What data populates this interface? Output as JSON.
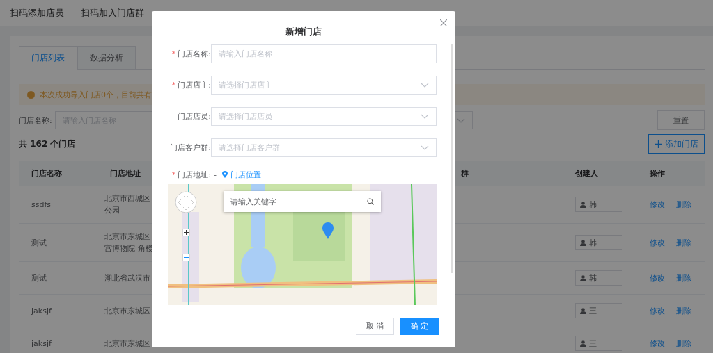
{
  "top_nav": {
    "items": [
      {
        "label": "扫码添加店员"
      },
      {
        "label": "扫码加入门店群"
      }
    ]
  },
  "tabs": [
    {
      "label": "门店列表",
      "selected": true
    },
    {
      "label": "数据分析",
      "selected": false
    }
  ],
  "alert": {
    "text": "本次成功导入门店0个，目前共有"
  },
  "filter": {
    "label": "门店名称:",
    "placeholder": "请输入门店名称",
    "reset_button": "重置"
  },
  "summary": "共 162 个门店",
  "add_button": "添加门店",
  "table": {
    "columns": [
      "门店名称",
      "门店地址",
      "群",
      "创建人",
      "操作"
    ],
    "rows": [
      {
        "name": "ssdfs",
        "address": [
          "北京市西城区",
          "公园"
        ],
        "creator": "韩",
        "actions": [
          "修改",
          "删除"
        ]
      },
      {
        "name": "测试",
        "address": [
          "北京市东城区",
          "宫博物院-角楼"
        ],
        "creator": "韩",
        "actions": [
          "修改",
          "删除"
        ]
      },
      {
        "name": "测试",
        "address": [
          "湖北省武汉市"
        ],
        "creator": "韩",
        "actions": [
          "修改",
          "删除"
        ]
      },
      {
        "name": "jaksjf",
        "address": [
          "北京市东城区"
        ],
        "creator": "王",
        "actions": [
          "修改",
          "删除"
        ]
      },
      {
        "name": "jaksjf",
        "address": [
          "北京市东城区"
        ],
        "creator": "王",
        "actions": [
          "修改",
          "删除"
        ]
      }
    ]
  },
  "dialog": {
    "title": "新增门店",
    "required_mark": "*",
    "fields": [
      {
        "label": "门店名称:",
        "required": true,
        "kind": "input",
        "placeholder": "请输入门店名称"
      },
      {
        "label": "门店店主:",
        "required": true,
        "kind": "select",
        "placeholder": "请选择门店店主"
      },
      {
        "label": "门店店员:",
        "required": false,
        "kind": "select",
        "placeholder": "请选择门店店员"
      },
      {
        "label": "门店客户群:",
        "required": false,
        "kind": "select",
        "placeholder": "请选择门店客户群"
      }
    ],
    "address": {
      "label": "门店地址:",
      "required": true,
      "value": "-",
      "link": "门店位置"
    },
    "map_search": {
      "placeholder": "请输入关键字"
    },
    "buttons": {
      "cancel": "取 消",
      "confirm": "确 定"
    }
  }
}
